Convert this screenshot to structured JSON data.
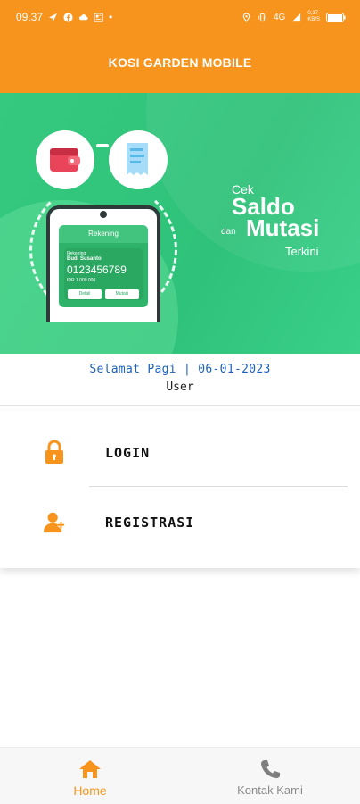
{
  "status_bar": {
    "time": "09.37",
    "network": "4G",
    "speed_top": "0,37",
    "speed_bottom": "KB/S"
  },
  "app_bar": {
    "title": "KOSI GARDEN MOBILE"
  },
  "banner": {
    "card_header": "Rekening",
    "card_small_label": "Rekening",
    "card_name": "Budi Susanto",
    "card_account": "0123456789",
    "card_balance": "IDR 1.000.000",
    "card_button_1": "Detail",
    "card_button_2": "Mutasi",
    "promo_cek": "Cek",
    "promo_saldo": "Saldo",
    "promo_dan": "dan",
    "promo_mutasi": "Mutasi",
    "promo_terkini": "Terkini"
  },
  "greeting": {
    "line1": "Selamat Pagi | 06-01-2023",
    "line2": "User"
  },
  "menu": {
    "items": [
      {
        "label": "LOGIN",
        "icon": "lock-icon"
      },
      {
        "label": "REGISTRASI",
        "icon": "add-user-icon"
      }
    ]
  },
  "bottom_nav": {
    "items": [
      {
        "label": "Home",
        "icon": "home-icon",
        "active": true
      },
      {
        "label": "Kontak Kami",
        "icon": "phone-icon",
        "active": false
      }
    ]
  },
  "colors": {
    "primary": "#f7941d",
    "banner_green": "#35c97f",
    "greeting_blue": "#1e62b8"
  }
}
